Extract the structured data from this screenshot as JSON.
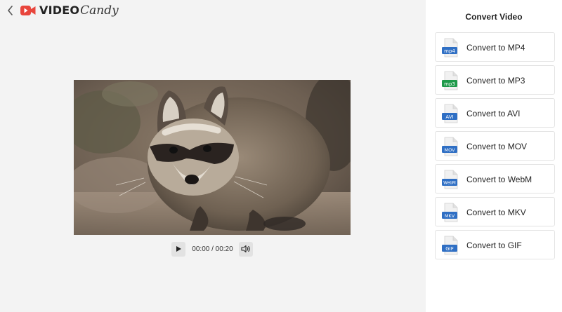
{
  "app": {
    "logo_text_bold": "VIDEO",
    "logo_text_script": "Candy"
  },
  "player": {
    "time_display": "00:00 / 00:20"
  },
  "sidebar": {
    "title": "Convert Video",
    "options": [
      {
        "label": "Convert to MP4",
        "badge": "mp4",
        "color": "#2f6fc4"
      },
      {
        "label": "Convert to MP3",
        "badge": "mp3",
        "color": "#1e9a4a"
      },
      {
        "label": "Convert to AVI",
        "badge": "AVI",
        "color": "#2f6fc4"
      },
      {
        "label": "Convert to MOV",
        "badge": "MOV",
        "color": "#2f6fc4"
      },
      {
        "label": "Convert to WebM",
        "badge": "WebM",
        "color": "#2f6fc4"
      },
      {
        "label": "Convert to MKV",
        "badge": "MKV",
        "color": "#2f6fc4"
      },
      {
        "label": "Convert to GIF",
        "badge": "GIF",
        "color": "#2f6fc4"
      }
    ]
  },
  "colors": {
    "accent": "#e8453c",
    "panel": "#ffffff",
    "background": "#f3f3f3"
  }
}
